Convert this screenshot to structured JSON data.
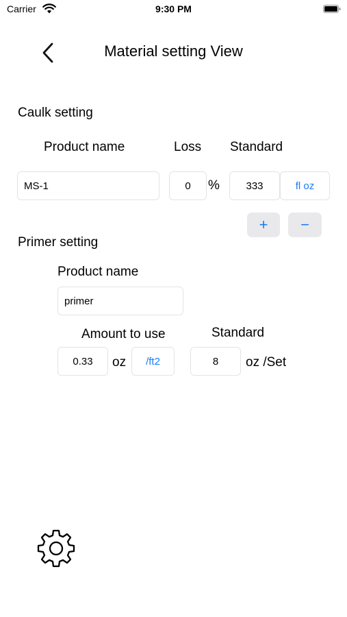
{
  "status_bar": {
    "carrier": "Carrier",
    "time": "9:30 PM"
  },
  "nav": {
    "title": "Material setting View",
    "back_icon": "chevron-left-icon"
  },
  "caulk": {
    "section_title": "Caulk setting",
    "product_name_label": "Product name",
    "loss_label": "Loss",
    "standard_label": "Standard",
    "product_name_value": "MS-1",
    "loss_value": "0",
    "loss_unit": "%",
    "standard_value": "333",
    "standard_unit_button": "fl oz",
    "plus_label": "+",
    "minus_label": "−"
  },
  "primer": {
    "section_title": "Primer setting",
    "product_name_label": "Product name",
    "product_name_value": "primer",
    "amount_label": "Amount to use",
    "standard_label": "Standard",
    "amount_value": "0.33",
    "amount_unit": "oz",
    "amount_per_button": "/ft2",
    "standard_value": "8",
    "standard_unit": "oz /Set"
  },
  "footer": {
    "settings_icon": "gear-icon"
  },
  "colors": {
    "accent": "#1a7cf0",
    "field_border": "#e3e3e6",
    "button_bg": "#e9e9ec"
  }
}
